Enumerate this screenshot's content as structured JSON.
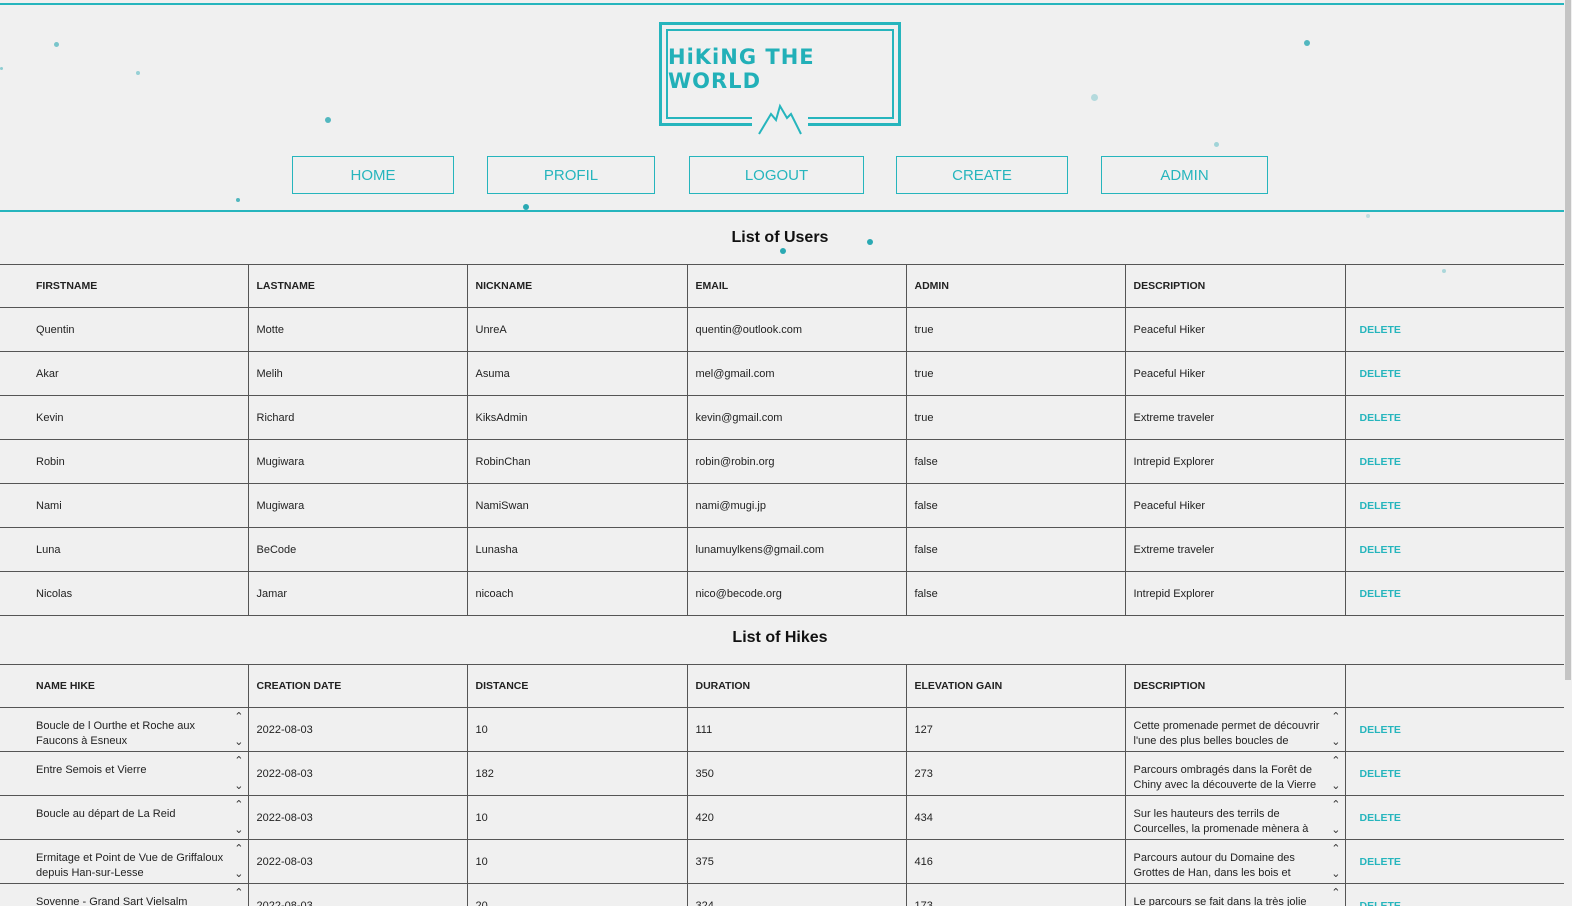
{
  "logo": {
    "title": "HiKiNG THE WORLD"
  },
  "nav": [
    "HOME",
    "PROFIL",
    "LOGOUT",
    "CREATE",
    "ADMIN"
  ],
  "users": {
    "title": "List of Users",
    "columns": [
      "FIRSTNAME",
      "LASTNAME",
      "NICKNAME",
      "EMAIL",
      "ADMIN",
      "DESCRIPTION",
      ""
    ],
    "action_label": "DELETE",
    "rows": [
      [
        "Quentin",
        "Motte",
        "UnreA",
        "quentin@outlook.com",
        "true",
        "Peaceful Hiker"
      ],
      [
        "Akar",
        "Melih",
        "Asuma",
        "mel@gmail.com",
        "true",
        "Peaceful Hiker"
      ],
      [
        "Kevin",
        "Richard",
        "KiksAdmin",
        "kevin@gmail.com",
        "true",
        "Extreme traveler"
      ],
      [
        "Robin",
        "Mugiwara",
        "RobinChan",
        "robin@robin.org",
        "false",
        "Intrepid Explorer"
      ],
      [
        "Nami",
        "Mugiwara",
        "NamiSwan",
        "nami@mugi.jp",
        "false",
        "Peaceful Hiker"
      ],
      [
        "Luna",
        "BeCode",
        "Lunasha",
        "lunamuylkens@gmail.com",
        "false",
        "Extreme traveler"
      ],
      [
        "Nicolas",
        "Jamar",
        "nicoach",
        "nico@becode.org",
        "false",
        "Intrepid Explorer"
      ]
    ]
  },
  "hikes": {
    "title": "List of Hikes",
    "columns": [
      "NAME HIKE",
      "CREATION DATE",
      "DISTANCE",
      "DURATION",
      "ELEVATION GAIN",
      "DESCRIPTION",
      ""
    ],
    "action_label": "DELETE",
    "rows": [
      [
        "Boucle de l Ourthe et Roche aux Faucons à Esneux",
        "2022-08-03",
        "10",
        "111",
        "127",
        "Cette promenade permet de découvrir l'une des plus belles boucles de l'Ourthe"
      ],
      [
        "Entre Semois et Vierre",
        "2022-08-03",
        "182",
        "350",
        "273",
        "Parcours ombragés dans la Forêt de Chiny avec la découverte de la Vierre sauvage"
      ],
      [
        "Boucle au départ de La Reid",
        "2022-08-03",
        "10",
        "420",
        "434",
        "Sur les hauteurs des terrils de Courcelles, la promenade mènera à des sentiers bien"
      ],
      [
        "Ermitage et Point de Vue de Griffaloux depuis Han-sur-Lesse",
        "2022-08-03",
        "10",
        "375",
        "416",
        "Parcours autour du Domaine des Grottes de Han, dans les bois et campagne de"
      ],
      [
        "Sovenne - Grand Sart Vielsalm",
        "2022-08-03",
        "20",
        "324",
        "173",
        "Le parcours se fait dans la très jolie"
      ]
    ]
  }
}
